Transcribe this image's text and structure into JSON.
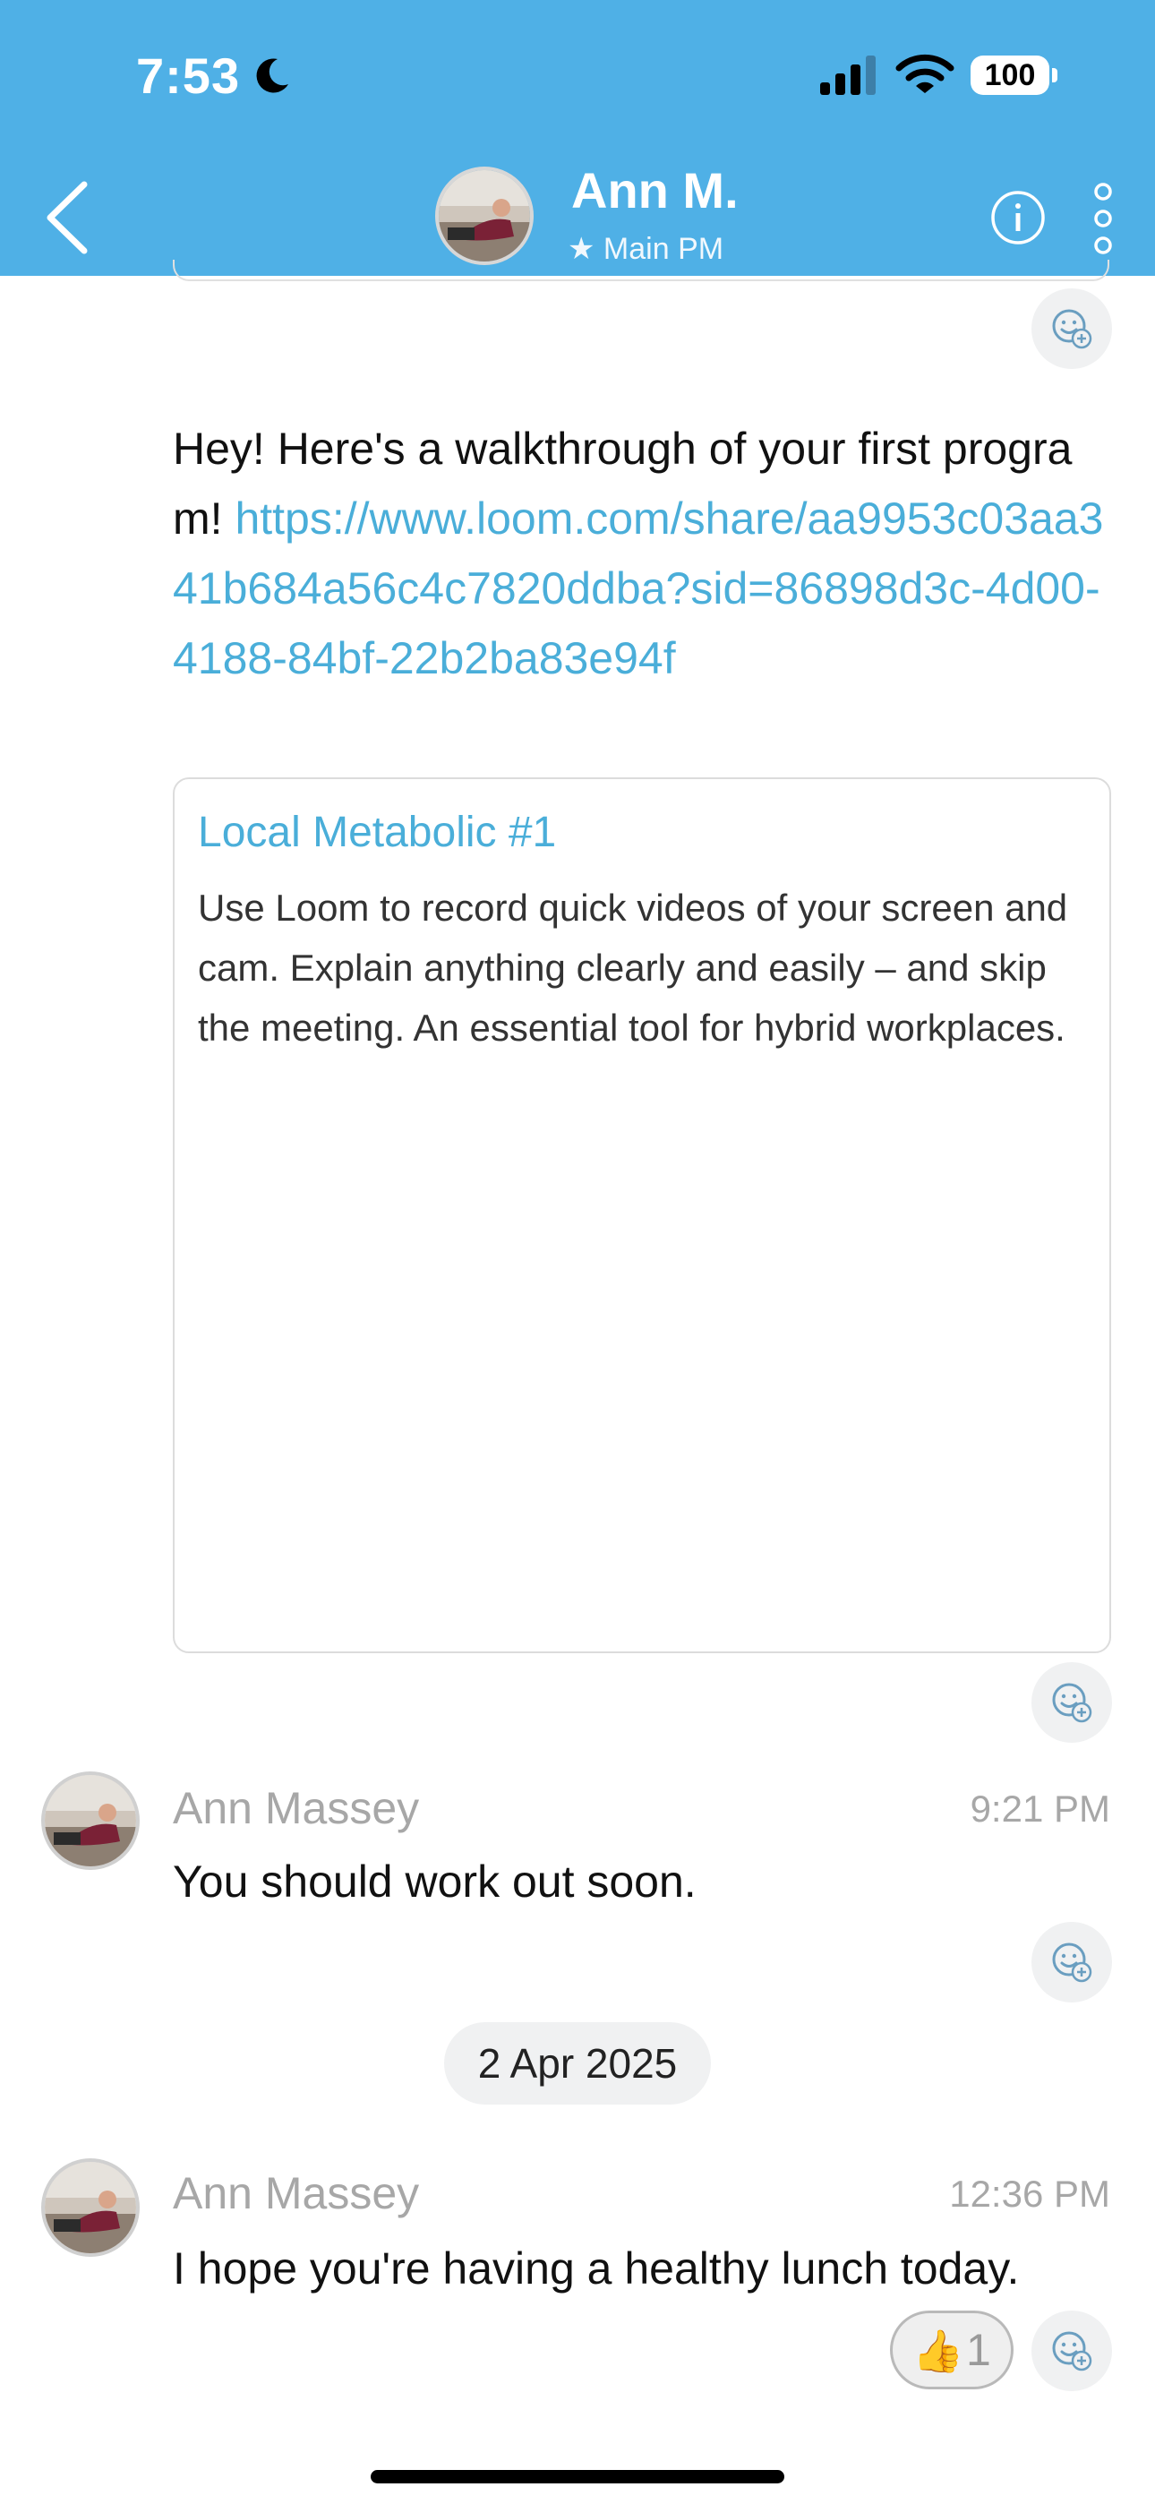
{
  "status_bar": {
    "time": "7:53",
    "battery": "100"
  },
  "header": {
    "name": "Ann M.",
    "role": "★ Main PM"
  },
  "messages": [
    {
      "text_prefix": "Hey!  Here's a walkthrough of your first program!  ",
      "link": "https://www.loom.com/share/aa9953c03aa341b684a56c4c7820ddba?sid=86898d3c-4d00-4188-84bf-22b2ba83e94f",
      "preview": {
        "title": "Local Metabolic #1",
        "description": "Use Loom to record quick videos of your screen and cam. Explain anything clearly and easily – and skip the meeting. An essential tool for hybrid workplaces."
      }
    },
    {
      "sender": "Ann Massey",
      "time": "9:21 PM",
      "text": "You should work out soon."
    },
    {
      "sender": "Ann Massey",
      "time": "12:36 PM",
      "text": "I hope you're having a healthy lunch today.",
      "reaction": {
        "emoji": "👍",
        "count": "1"
      }
    }
  ],
  "date_separator": "2 Apr 2025",
  "colors": {
    "header": "#4fb0e6",
    "link": "#4aaed9",
    "muted": "#a7a7a7"
  }
}
